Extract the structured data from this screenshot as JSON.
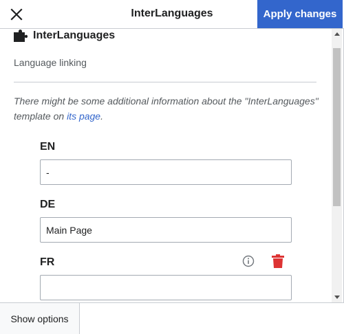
{
  "header": {
    "title": "InterLanguages",
    "apply_label": "Apply changes",
    "close_icon": "close-icon"
  },
  "template": {
    "name": "InterLanguages",
    "icon": "puzzle-icon",
    "description": "Language linking",
    "note_prefix": "There might be some additional information about the \"InterLanguages\" template on ",
    "note_link": "its page",
    "note_suffix": "."
  },
  "params": [
    {
      "label": "EN",
      "value": "-"
    },
    {
      "label": "DE",
      "value": "Main Page"
    },
    {
      "label": "FR",
      "value": ""
    }
  ],
  "footer": {
    "show_options_label": "Show options"
  },
  "colors": {
    "accent": "#3366cc",
    "danger": "#d33"
  }
}
